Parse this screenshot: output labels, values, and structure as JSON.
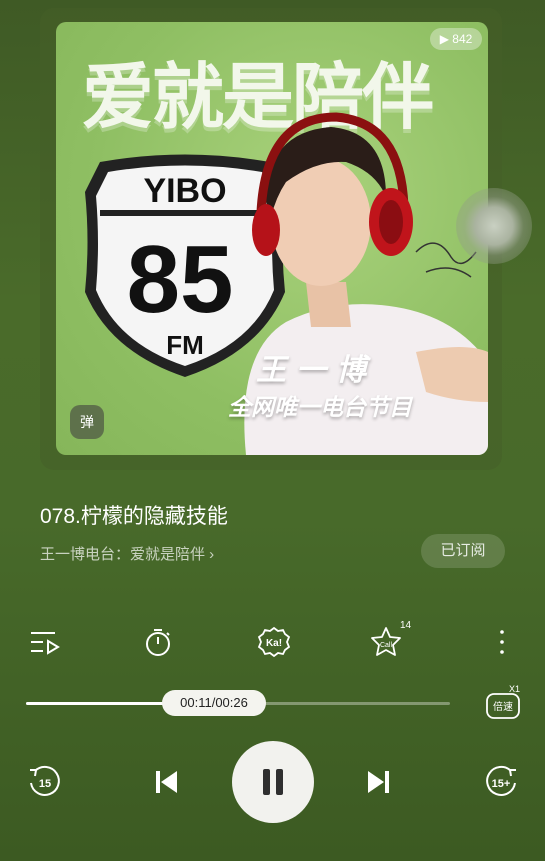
{
  "cover": {
    "title": "爱就是陪伴",
    "view_count": "▶ 842",
    "badge_top": "YIBO",
    "badge_number": "85",
    "badge_unit": "FM",
    "host_name": "王一博",
    "subtitle": "全网唯一电台节目",
    "danmaku_label": "弹"
  },
  "track": {
    "title": "078.柠檬的隐藏技能",
    "channel": "王一博电台：爱就是陪伴 ›",
    "subscribe_label": "已订阅"
  },
  "actions": {
    "call_count": "14"
  },
  "progress": {
    "time_display": "00:11/00:26",
    "fraction": 0.42,
    "speed_label": "倍速",
    "speed_value": "X1"
  },
  "controls": {
    "rewind_label": "15",
    "forward_label": "15+"
  },
  "colors": {
    "accent": "#f2f2ee",
    "background": "#46672a"
  }
}
